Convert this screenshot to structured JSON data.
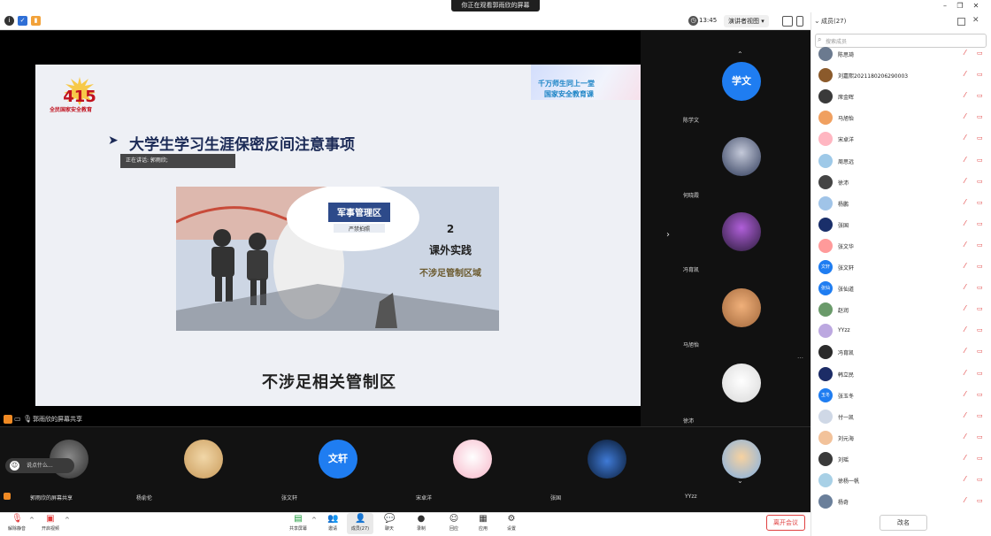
{
  "banner": {
    "sharing_text": "你正在观看郭雨欣的屏幕"
  },
  "toolbar": {
    "time": "13:45",
    "view_mode": "演讲者视图"
  },
  "slide": {
    "logo_number": "415",
    "logo_text": "全民国家安全教育",
    "slogan_line1": "千万师生同上一堂",
    "slogan_line2": "国家安全教育课",
    "title": "大学生学习生涯保密反间注意事项",
    "speaking_label": "正在讲话: 郭雨欣;",
    "sign_text": "军事管理区",
    "sign_sub": "严禁拍照",
    "number": "2",
    "subtitle": "课外实践",
    "subsubtitle": "不涉足管制区域",
    "caption": "不涉足相关管制区"
  },
  "share_label": "郭雨欣的屏幕共享",
  "right_videos": [
    {
      "name": "陈学文",
      "initials": "学文"
    },
    {
      "name": "何晓霞"
    },
    {
      "name": "冯育凯"
    },
    {
      "name": "马旭怡"
    },
    {
      "name": "徐沛"
    },
    {
      "name": "YYzz"
    }
  ],
  "bottom_videos": [
    {
      "name": "郭雨欣的屏幕共享"
    },
    {
      "name": "杨俞伦"
    },
    {
      "name": "张文轩",
      "initials": "文轩"
    },
    {
      "name": "宋卓洋"
    },
    {
      "name": "张国"
    }
  ],
  "reaction_placeholder": "说点什么...",
  "controls": {
    "unmute": "解除静音",
    "start_video": "开启视频",
    "share_screen": "共享屏幕",
    "invite": "邀请",
    "participants": "成员(27)",
    "chat": "聊天",
    "record": "录制",
    "reactions": "回应",
    "apps": "应用",
    "settings": "设置",
    "leave": "离开会议"
  },
  "panel": {
    "title": "成员(27)",
    "search_placeholder": "搜索成员",
    "rename_button": "改名",
    "members": [
      {
        "name": "陈思琦"
      },
      {
        "name": "刘嘉熙2021180206290003"
      },
      {
        "name": "席金晖"
      },
      {
        "name": "马旭怡"
      },
      {
        "name": "宋卓洋"
      },
      {
        "name": "周思远"
      },
      {
        "name": "徐沛"
      },
      {
        "name": "杨鹏"
      },
      {
        "name": "张国"
      },
      {
        "name": "张文华"
      },
      {
        "name": "张文轩",
        "initials": "文轩"
      },
      {
        "name": "张仙道",
        "initials": "张仙"
      },
      {
        "name": "赵润"
      },
      {
        "name": "YYzz"
      },
      {
        "name": "冯育凯"
      },
      {
        "name": "韩立民"
      },
      {
        "name": "张玉冬",
        "initials": "玉冬"
      },
      {
        "name": "付一凯"
      },
      {
        "name": "刘元海"
      },
      {
        "name": "刘瑶"
      },
      {
        "name": "徐杨一帆"
      },
      {
        "name": "杨奇"
      }
    ]
  },
  "colors": {
    "accent_blue": "#1f7df1",
    "muted_red": "#e03b3b",
    "leave_red": "#e04040"
  }
}
